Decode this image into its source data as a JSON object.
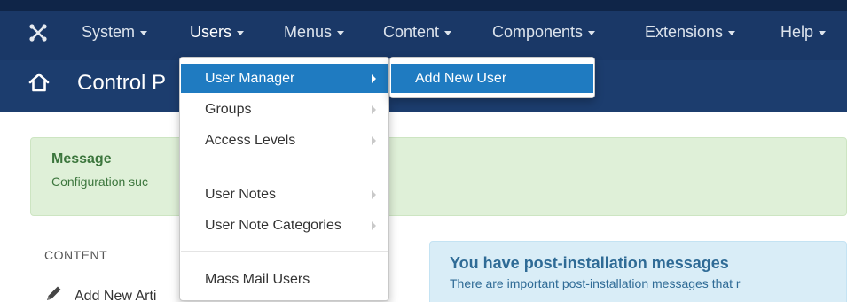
{
  "navbar": {
    "logo_icon": "joomla-logo-icon",
    "items": [
      {
        "label": "System"
      },
      {
        "label": "Users"
      },
      {
        "label": "Menus"
      },
      {
        "label": "Content"
      },
      {
        "label": "Components"
      },
      {
        "label": "Extensions"
      },
      {
        "label": "Help"
      }
    ]
  },
  "subheader": {
    "home_icon": "home-icon",
    "title": "Control P"
  },
  "alert": {
    "heading": "Message",
    "text": "Configuration suc"
  },
  "content": {
    "section_heading": "CONTENT",
    "link_label": "Add New Arti"
  },
  "info": {
    "heading": "You have post-installation messages",
    "text": "There are important post-installation messages that r"
  },
  "users_menu": {
    "items": [
      {
        "label": "User Manager"
      },
      {
        "label": "Groups"
      },
      {
        "label": "Access Levels"
      },
      {
        "label": "User Notes"
      },
      {
        "label": "User Note Categories"
      },
      {
        "label": "Mass Mail Users"
      }
    ]
  },
  "user_manager_submenu": {
    "items": [
      {
        "label": "Add New User"
      }
    ]
  },
  "colors": {
    "navbar": "#1a3867",
    "subheader": "#1c3d6e",
    "menu_active": "#1f7bc1",
    "alert_bg": "#dff0d8",
    "info_bg": "#d9edf7"
  }
}
